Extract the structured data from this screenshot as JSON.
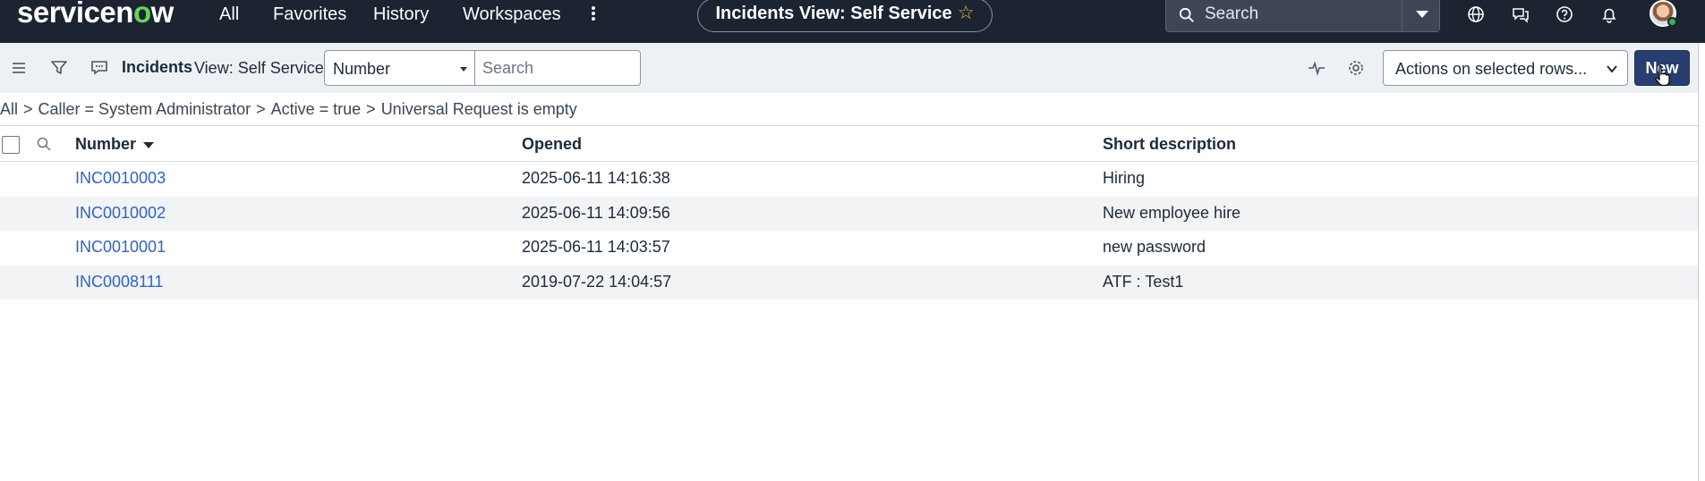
{
  "header": {
    "logo_text_pre": "servicen",
    "logo_text_o": "o",
    "logo_text_post": "w",
    "nav": [
      "All",
      "Favorites",
      "History",
      "Workspaces"
    ],
    "page_title": "Incidents View: Self Service",
    "search_placeholder": "Search"
  },
  "toolbar": {
    "list_title": "Incidents",
    "view_label": "View: Self Service",
    "field_select_value": "Number",
    "search_placeholder": "Search",
    "actions_value": "Actions on selected rows...",
    "new_label": "New"
  },
  "breadcrumb": [
    "All",
    "Caller = System Administrator",
    "Active = true",
    "Universal Request is empty"
  ],
  "table": {
    "columns": [
      "Number",
      "Opened",
      "Short description"
    ],
    "rows": [
      {
        "number": "INC0010003",
        "opened": "2025-06-11 14:16:38",
        "short_description": "Hiring"
      },
      {
        "number": "INC0010002",
        "opened": "2025-06-11 14:09:56",
        "short_description": "New employee hire"
      },
      {
        "number": "INC0010001",
        "opened": "2025-06-11 14:03:57",
        "short_description": "new password"
      },
      {
        "number": "INC0008111",
        "opened": "2019-07-22 14:04:57",
        "short_description": "ATF : Test1"
      }
    ]
  },
  "colors": {
    "header_bg": "#1c2331",
    "brand_green": "#62d84e",
    "link": "#2e62cc",
    "primary_button": "#293e70"
  },
  "icons": [
    "menu-icon",
    "filter-icon",
    "comment-icon",
    "search-icon",
    "globe-icon",
    "chat-icon",
    "help-icon",
    "bell-icon",
    "activity-icon",
    "gear-icon",
    "star-icon",
    "chevron-down-icon"
  ]
}
